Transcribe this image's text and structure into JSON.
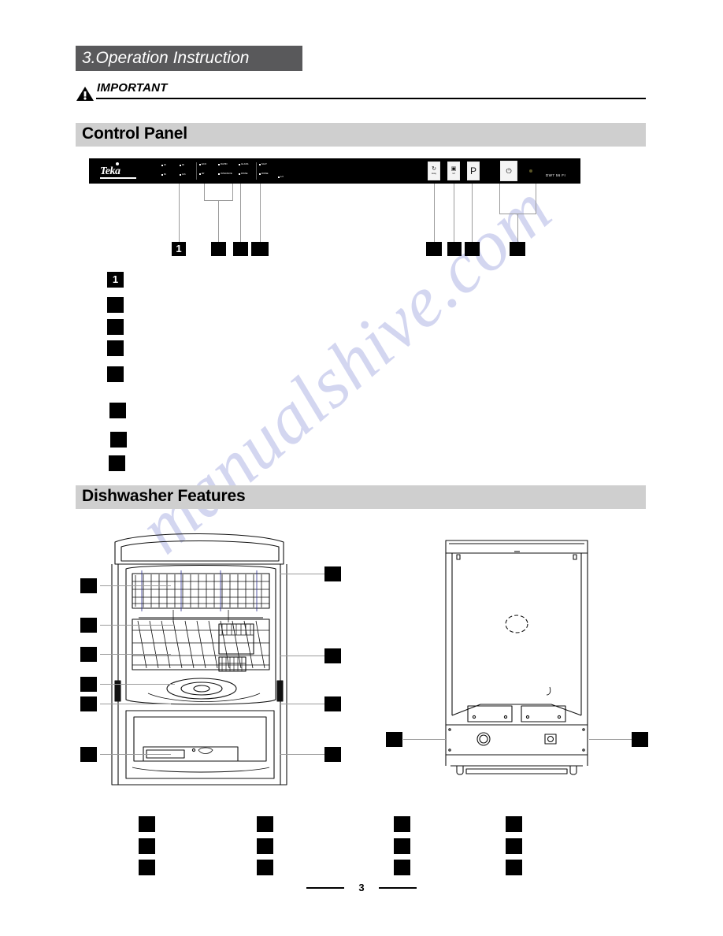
{
  "document": {
    "chapter_title": "3.Operation Instruction",
    "important_label": "IMPORTANT",
    "page_number": "3",
    "watermark": "manualshive.com"
  },
  "sections": {
    "control_panel": {
      "heading": "Control Panel"
    },
    "dishwasher_features": {
      "heading": "Dishwasher Features"
    }
  },
  "control_panel_graphic": {
    "brand": "Teka",
    "model": "DW7 56 FI",
    "delay_indicators": [
      {
        "label": "3h"
      },
      {
        "label": "9h"
      },
      {
        "label": "6h"
      },
      {
        "label": "12h"
      }
    ],
    "program_indicators": [
      {
        "label": "ECO"
      },
      {
        "label": "90'"
      },
      {
        "label": "RAPID"
      },
      {
        "label": "INTENSIVE"
      },
      {
        "label": "GLASS"
      },
      {
        "label": "SALT"
      },
      {
        "label": "RINSE"
      },
      {
        "label": "1/2"
      }
    ],
    "buttons": [
      {
        "id": "delay-button",
        "glyph": "↻",
        "sub": "delay"
      },
      {
        "id": "half-load-button",
        "glyph": "▣",
        "sub": "1/2"
      },
      {
        "id": "program-button",
        "glyph": "P",
        "sub": ""
      },
      {
        "id": "power-button",
        "glyph": "⏻",
        "sub": ""
      }
    ],
    "power_led": {
      "label": "led-indicator"
    }
  },
  "control_panel_callouts": {
    "row": [
      {
        "label": "1",
        "redacted": false
      },
      {
        "label": "",
        "redacted": true
      },
      {
        "label": "",
        "redacted": true
      },
      {
        "label": "",
        "redacted": true
      },
      {
        "label": "",
        "redacted": true
      },
      {
        "label": "",
        "redacted": true
      },
      {
        "label": "",
        "redacted": true
      },
      {
        "label": "",
        "redacted": true
      }
    ]
  },
  "control_panel_legend": [
    {
      "label": "1",
      "redacted": false
    },
    {
      "label": "",
      "redacted": true
    },
    {
      "label": "",
      "redacted": true
    },
    {
      "label": "",
      "redacted": true
    },
    {
      "label": "",
      "redacted": true
    },
    {
      "label": "",
      "redacted": true
    },
    {
      "label": "",
      "redacted": true
    },
    {
      "label": "",
      "redacted": true
    }
  ],
  "features_callouts": {
    "interior_left": [
      {
        "label": "",
        "redacted": true
      },
      {
        "label": "",
        "redacted": true
      },
      {
        "label": "",
        "redacted": true
      },
      {
        "label": "",
        "redacted": true
      },
      {
        "label": "",
        "redacted": true
      },
      {
        "label": "",
        "redacted": true
      }
    ],
    "interior_right": [
      {
        "label": "",
        "redacted": true
      },
      {
        "label": "",
        "redacted": true
      },
      {
        "label": "",
        "redacted": true
      },
      {
        "label": "",
        "redacted": true
      }
    ],
    "rear_left": [
      {
        "label": "",
        "redacted": true
      }
    ],
    "rear_right": [
      {
        "label": "",
        "redacted": true
      }
    ]
  },
  "features_legend": {
    "columns": [
      [
        {
          "label": "",
          "redacted": true
        },
        {
          "label": "",
          "redacted": true
        },
        {
          "label": "",
          "redacted": true
        }
      ],
      [
        {
          "label": "",
          "redacted": true
        },
        {
          "label": "",
          "redacted": true
        },
        {
          "label": "",
          "redacted": true
        }
      ],
      [
        {
          "label": "",
          "redacted": true
        },
        {
          "label": "",
          "redacted": true
        },
        {
          "label": "",
          "redacted": true
        }
      ],
      [
        {
          "label": "",
          "redacted": true
        },
        {
          "label": "",
          "redacted": true
        },
        {
          "label": "",
          "redacted": true
        }
      ]
    ]
  },
  "colors": {
    "chapter_bar": "#59595b",
    "section_bar": "#cfcfcf",
    "panel": "#000000",
    "watermark": "#b9bde8",
    "page_background": "#ffffff"
  }
}
